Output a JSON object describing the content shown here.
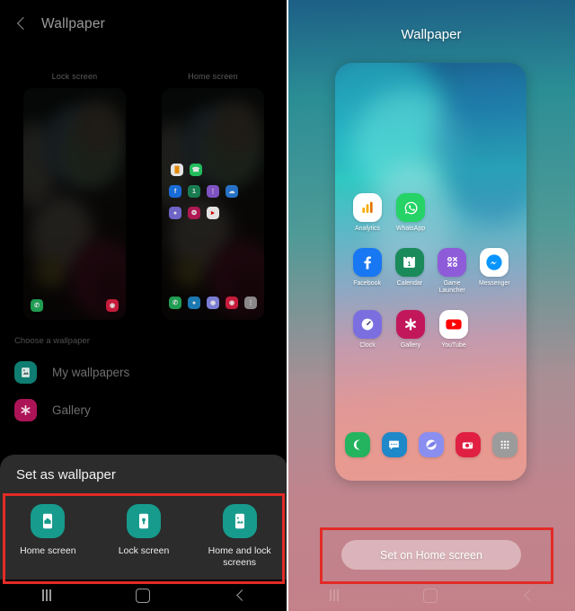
{
  "left": {
    "header": {
      "back_icon": "back-chevron-icon",
      "title": "Wallpaper"
    },
    "previews": [
      {
        "label": "Lock screen"
      },
      {
        "label": "Home screen"
      }
    ],
    "choose_label": "Choose a wallpaper",
    "list": [
      {
        "label": "My wallpapers",
        "icon": "image-icon",
        "color": "#0f7d71"
      },
      {
        "label": "Gallery",
        "icon": "flower-icon",
        "color": "#ad1457"
      }
    ],
    "sheet": {
      "title": "Set as wallpaper",
      "options": [
        {
          "label": "Home screen",
          "icon": "home-screen-icon"
        },
        {
          "label": "Lock screen",
          "icon": "lock-screen-icon"
        },
        {
          "label": "Home and lock screens",
          "icon": "home-and-lock-icon"
        }
      ],
      "accent": "#169b8c"
    }
  },
  "right": {
    "title": "Wallpaper",
    "apps": [
      [
        {
          "label": "Analytics",
          "icon": "analytics-icon",
          "color": "#ffffff"
        },
        {
          "label": "WhatsApp",
          "icon": "whatsapp-icon",
          "color": "#25d366"
        }
      ],
      [
        {
          "label": "Facebook",
          "icon": "facebook-icon",
          "color": "#1877f2"
        },
        {
          "label": "Calendar",
          "icon": "calendar-icon",
          "color": "#1a8a5a"
        },
        {
          "label": "Game Launcher",
          "icon": "game-launcher-icon",
          "color": "#8e5cd9"
        },
        {
          "label": "Messenger",
          "icon": "messenger-icon",
          "color": "#ffffff"
        }
      ],
      [
        {
          "label": "Clock",
          "icon": "clock-icon",
          "color": "#7b6fe0"
        },
        {
          "label": "Gallery",
          "icon": "gallery-icon",
          "color": "#c2185b"
        },
        {
          "label": "YouTube",
          "icon": "youtube-icon",
          "color": "#ffffff"
        }
      ]
    ],
    "dock": [
      {
        "name": "phone-icon",
        "color": "#24b35e"
      },
      {
        "name": "messages-icon",
        "color": "#1f88c9"
      },
      {
        "name": "internet-icon",
        "color": "#8a8ef0"
      },
      {
        "name": "camera-icon",
        "color": "#e01f42"
      },
      {
        "name": "apps-grid-icon",
        "color": "#9b9b9b"
      }
    ],
    "set_button": "Set on Home screen"
  },
  "navbar": {
    "recents": "recents-icon",
    "home": "home-icon",
    "back": "back-icon"
  },
  "annotation_color": "#e22b26"
}
